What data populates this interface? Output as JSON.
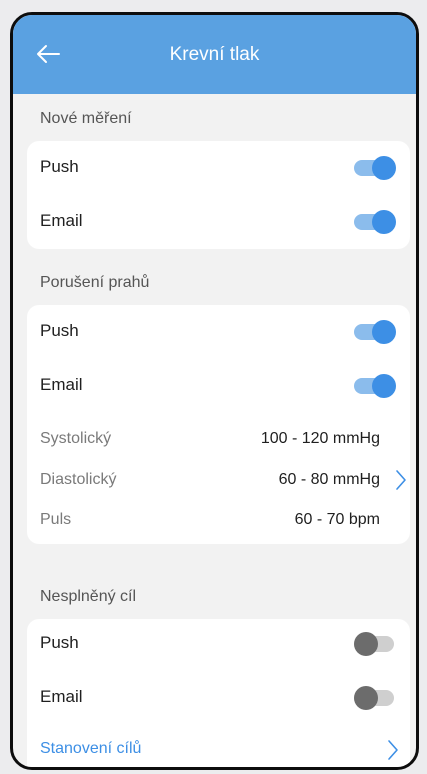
{
  "header": {
    "title": "Krevní tlak",
    "back_icon": "arrow-left-icon"
  },
  "sections": {
    "new_measurement": {
      "label": "Nové měření",
      "push_label": "Push",
      "push_enabled": true,
      "email_label": "Email",
      "email_enabled": true
    },
    "threshold_breach": {
      "label": "Porušení prahů",
      "push_label": "Push",
      "push_enabled": true,
      "email_label": "Email",
      "email_enabled": true,
      "ranges": [
        {
          "label": "Systolický",
          "value": "100 - 120 mmHg"
        },
        {
          "label": "Diastolický",
          "value": "60 - 80 mmHg"
        },
        {
          "label": "Puls",
          "value": "60 - 70 bpm"
        }
      ],
      "chevron_icon": "chevron-right-icon"
    },
    "unmet_goal": {
      "label": "Nesplněný cíl",
      "push_label": "Push",
      "push_enabled": false,
      "email_label": "Email",
      "email_enabled": false,
      "link_label": "Stanovení cílů",
      "chevron_icon": "chevron-right-icon"
    }
  },
  "colors": {
    "accent": "#3d8fe5",
    "appbar": "#5aa1e1",
    "toggle_on_track": "#8bbcec",
    "toggle_off_knob": "#6c6c6c",
    "toggle_off_track": "#cfcfcf"
  }
}
